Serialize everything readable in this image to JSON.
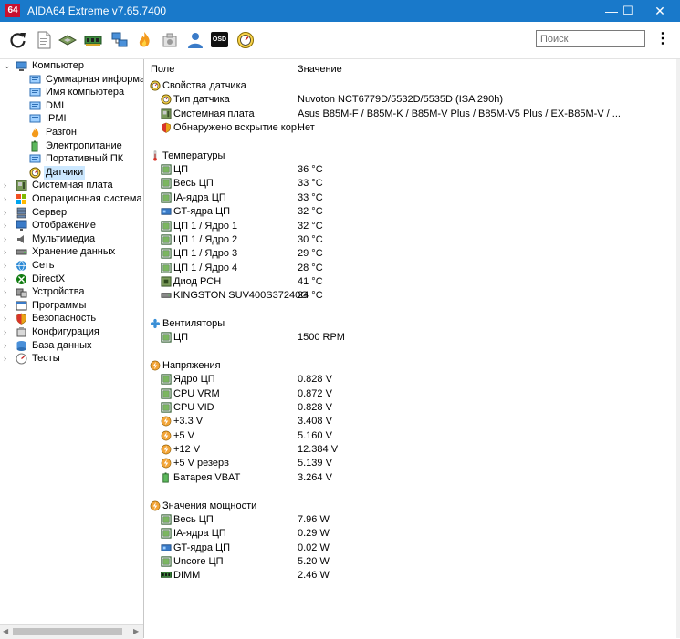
{
  "window": {
    "logo_text": "64",
    "title": "AIDA64 Extreme v7.65.7400",
    "min_glyph": "—",
    "max_glyph": "☐",
    "close_glyph": "✕"
  },
  "toolbar": {
    "icons": [
      "refresh-icon",
      "report-icon",
      "motherboard-icon",
      "memory-icon",
      "network-icon",
      "flame-icon",
      "tools-icon",
      "user-icon",
      "osd-icon",
      "gauge-icon"
    ],
    "osd_text": "OSD",
    "search_placeholder": "Поиск",
    "menu_glyph": "⋮"
  },
  "tree": {
    "items": [
      {
        "label": "Компьютер",
        "level": 0,
        "expander": "⌄",
        "icon": "computer-icon"
      },
      {
        "label": "Суммарная информация",
        "level": 1,
        "expander": "",
        "icon": "summary-icon"
      },
      {
        "label": "Имя компьютера",
        "level": 1,
        "expander": "",
        "icon": "computer-name-icon"
      },
      {
        "label": "DMI",
        "level": 1,
        "expander": "",
        "icon": "dmi-icon"
      },
      {
        "label": "IPMI",
        "level": 1,
        "expander": "",
        "icon": "ipmi-icon"
      },
      {
        "label": "Разгон",
        "level": 1,
        "expander": "",
        "icon": "flame-icon"
      },
      {
        "label": "Электропитание",
        "level": 1,
        "expander": "",
        "icon": "power-icon"
      },
      {
        "label": "Портативный ПК",
        "level": 1,
        "expander": "",
        "icon": "laptop-icon"
      },
      {
        "label": "Датчики",
        "level": 1,
        "expander": "",
        "icon": "sensor-icon",
        "selected": true
      },
      {
        "label": "Системная плата",
        "level": 0,
        "expander": "›",
        "icon": "motherboard-icon"
      },
      {
        "label": "Операционная система",
        "level": 0,
        "expander": "›",
        "icon": "windows-icon"
      },
      {
        "label": "Сервер",
        "level": 0,
        "expander": "›",
        "icon": "server-icon"
      },
      {
        "label": "Отображение",
        "level": 0,
        "expander": "›",
        "icon": "display-icon"
      },
      {
        "label": "Мультимедиа",
        "level": 0,
        "expander": "›",
        "icon": "multimedia-icon"
      },
      {
        "label": "Хранение данных",
        "level": 0,
        "expander": "›",
        "icon": "storage-icon"
      },
      {
        "label": "Сеть",
        "level": 0,
        "expander": "›",
        "icon": "network-icon"
      },
      {
        "label": "DirectX",
        "level": 0,
        "expander": "›",
        "icon": "directx-icon"
      },
      {
        "label": "Устройства",
        "level": 0,
        "expander": "›",
        "icon": "devices-icon"
      },
      {
        "label": "Программы",
        "level": 0,
        "expander": "›",
        "icon": "programs-icon"
      },
      {
        "label": "Безопасность",
        "level": 0,
        "expander": "›",
        "icon": "security-icon"
      },
      {
        "label": "Конфигурация",
        "level": 0,
        "expander": "›",
        "icon": "config-icon"
      },
      {
        "label": "База данных",
        "level": 0,
        "expander": "›",
        "icon": "database-icon"
      },
      {
        "label": "Тесты",
        "level": 0,
        "expander": "›",
        "icon": "tests-icon"
      }
    ]
  },
  "columns": {
    "field": "Поле",
    "value": "Значение"
  },
  "rows": [
    {
      "type": "section",
      "label": "Свойства датчика",
      "value": "",
      "icon": "sensor-icon"
    },
    {
      "type": "item",
      "label": "Тип датчика",
      "value": "Nuvoton NCT6779D/5532D/5535D  (ISA 290h)",
      "icon": "sensor-icon"
    },
    {
      "type": "item",
      "label": "Системная плата",
      "value": "Asus B85M-F / B85M-K / B85M-V Plus / B85M-V5 Plus / EX-B85M-V / ...",
      "icon": "motherboard-icon"
    },
    {
      "type": "item",
      "label": "Обнаружено вскрытие кор...",
      "value": "Нет",
      "icon": "shield-icon"
    },
    {
      "type": "gap"
    },
    {
      "type": "section",
      "label": "Температуры",
      "value": "",
      "icon": "thermometer-icon"
    },
    {
      "type": "item",
      "label": "ЦП",
      "value": "36 °C",
      "icon": "chip-icon"
    },
    {
      "type": "item",
      "label": "Весь ЦП",
      "value": "33 °C",
      "icon": "chip-icon"
    },
    {
      "type": "item",
      "label": "IA-ядра ЦП",
      "value": "33 °C",
      "icon": "chip-icon"
    },
    {
      "type": "item",
      "label": "GT-ядра ЦП",
      "value": "32 °C",
      "icon": "gpu-icon"
    },
    {
      "type": "item",
      "label": "ЦП 1 / Ядро 1",
      "value": "32 °C",
      "icon": "chip-icon"
    },
    {
      "type": "item",
      "label": "ЦП 1 / Ядро 2",
      "value": "30 °C",
      "icon": "chip-icon"
    },
    {
      "type": "item",
      "label": "ЦП 1 / Ядро 3",
      "value": "29 °C",
      "icon": "chip-icon"
    },
    {
      "type": "item",
      "label": "ЦП 1 / Ядро 4",
      "value": "28 °C",
      "icon": "chip-icon"
    },
    {
      "type": "item",
      "label": "Диод PCH",
      "value": "41 °C",
      "icon": "pch-icon"
    },
    {
      "type": "item",
      "label": "KINGSTON SUV400S37240G",
      "value": "24 °C",
      "icon": "drive-icon"
    },
    {
      "type": "gap"
    },
    {
      "type": "section",
      "label": "Вентиляторы",
      "value": "",
      "icon": "fan-icon"
    },
    {
      "type": "item",
      "label": "ЦП",
      "value": "1500 RPM",
      "icon": "chip-icon"
    },
    {
      "type": "gap"
    },
    {
      "type": "section",
      "label": "Напряжения",
      "value": "",
      "icon": "voltage-icon"
    },
    {
      "type": "item",
      "label": "Ядро ЦП",
      "value": "0.828 V",
      "icon": "chip-icon"
    },
    {
      "type": "item",
      "label": "CPU VRM",
      "value": "0.872 V",
      "icon": "chip-icon"
    },
    {
      "type": "item",
      "label": "CPU VID",
      "value": "0.828 V",
      "icon": "chip-icon"
    },
    {
      "type": "item",
      "label": "+3.3 V",
      "value": "3.408 V",
      "icon": "voltage-icon"
    },
    {
      "type": "item",
      "label": "+5 V",
      "value": "5.160 V",
      "icon": "voltage-icon"
    },
    {
      "type": "item",
      "label": "+12 V",
      "value": "12.384 V",
      "icon": "voltage-icon"
    },
    {
      "type": "item",
      "label": "+5 V резерв",
      "value": "5.139 V",
      "icon": "voltage-icon"
    },
    {
      "type": "item",
      "label": "Батарея VBAT",
      "value": "3.264 V",
      "icon": "battery-icon"
    },
    {
      "type": "gap"
    },
    {
      "type": "section",
      "label": "Значения мощности",
      "value": "",
      "icon": "voltage-icon"
    },
    {
      "type": "item",
      "label": "Весь ЦП",
      "value": "7.96 W",
      "icon": "chip-icon"
    },
    {
      "type": "item",
      "label": "IA-ядра ЦП",
      "value": "0.29 W",
      "icon": "chip-icon"
    },
    {
      "type": "item",
      "label": "GT-ядра ЦП",
      "value": "0.02 W",
      "icon": "gpu-icon"
    },
    {
      "type": "item",
      "label": "Uncore ЦП",
      "value": "5.20 W",
      "icon": "chip-icon"
    },
    {
      "type": "item",
      "label": "DIMM",
      "value": "2.46 W",
      "icon": "memory-icon"
    }
  ],
  "colors": {
    "title_bar": "#1979ca",
    "selection": "#cce8ff",
    "chip": "#7bb661"
  }
}
